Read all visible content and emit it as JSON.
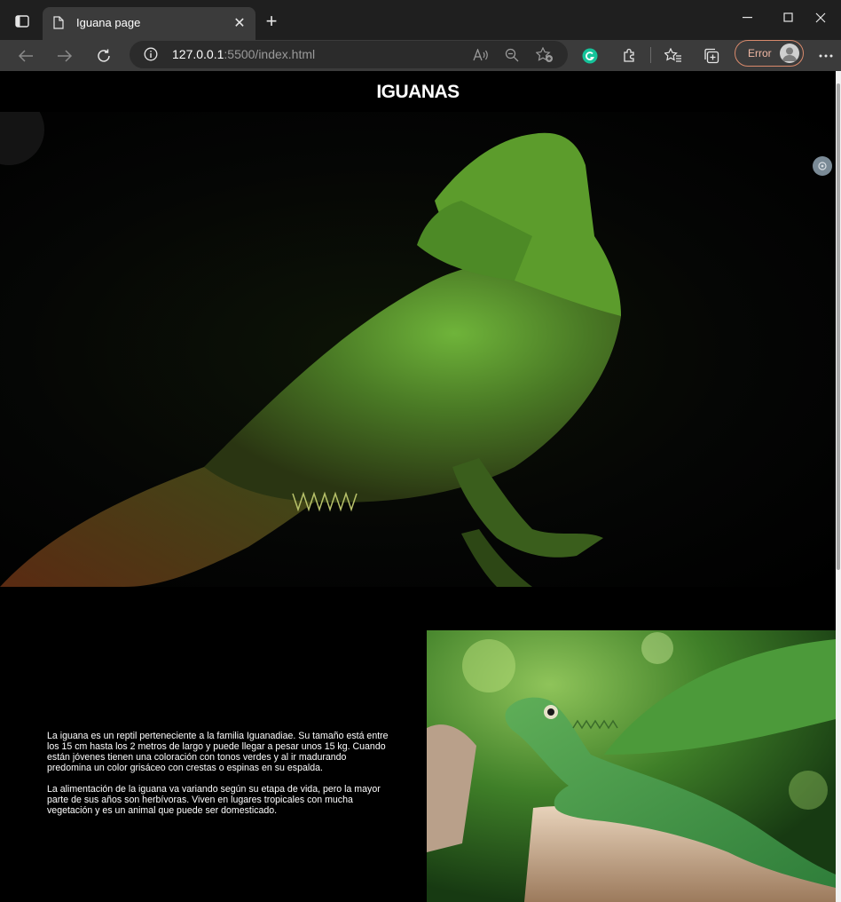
{
  "browser": {
    "tab_title": "Iguana page",
    "url_host": "127.0.0.1",
    "url_rest": ":5500/index.html",
    "error_label": "Error"
  },
  "page": {
    "title": "IGUANAS",
    "paragraphs": [
      "La iguana es un reptil perteneciente a la familia Iguanadiae. Su tamaño está entre los 15 cm hasta los 2 metros de largo y puede llegar a pesar unos 15 kg. Cuando están jóvenes tienen una coloración con tonos verdes y al ir madurando predomina un color grisáceo con crestas o espinas en su espalda.",
      "La alimentación de la iguana va variando según su etapa de vida, pero la mayor parte de sus años son herbívoras. Viven en lugares tropicales con mucha vegetación y es un animal que puede ser domesticado."
    ]
  },
  "colors": {
    "page_bg": "#000000",
    "tab_bg": "#3b3b3b",
    "error_accent": "#d98a6c",
    "grammarly": "#15c39a"
  }
}
